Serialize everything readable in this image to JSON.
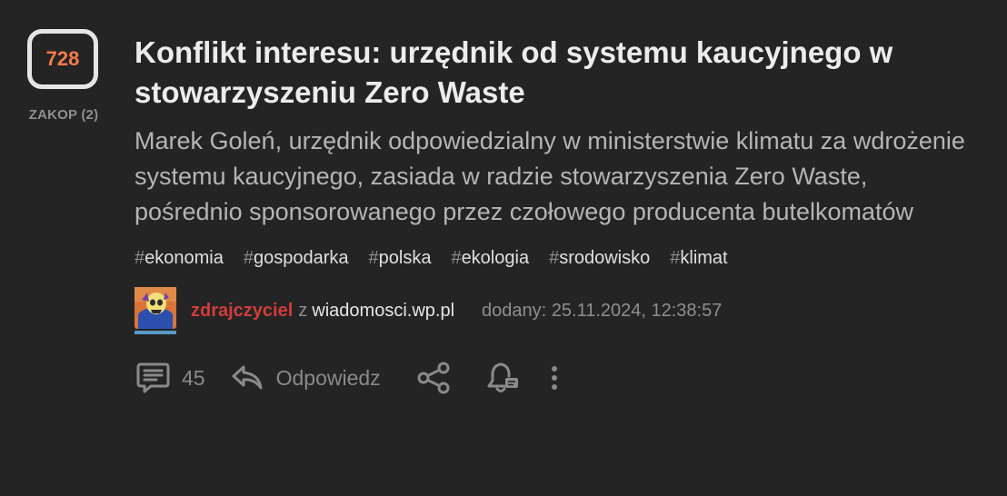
{
  "vote": {
    "count": "728",
    "bury_label": "ZAKOP (2)"
  },
  "article": {
    "title": "Konflikt interesu: urzędnik od systemu kaucyjnego w stowarzyszeniu Zero Waste",
    "description": "Marek Goleń, urzędnik odpowiedzialny w ministerstwie klimatu za wdrożenie systemu kaucyjnego, zasiada w radzie stowarzyszenia Zero Waste, pośrednio sponsorowanego przez czołowego producenta butelkomatów"
  },
  "tags": [
    {
      "hash": "#",
      "name": "ekonomia"
    },
    {
      "hash": "#",
      "name": "gospodarka"
    },
    {
      "hash": "#",
      "name": "polska"
    },
    {
      "hash": "#",
      "name": "ekologia"
    },
    {
      "hash": "#",
      "name": "srodowisko"
    },
    {
      "hash": "#",
      "name": "klimat"
    }
  ],
  "meta": {
    "author": "zdrajczyciel",
    "from_word": "z",
    "source": "wiadomosci.wp.pl",
    "added": "dodany: 25.11.2024, 12:38:57",
    "avatar_icon": "skeletor-avatar"
  },
  "actions": {
    "comments_icon": "comments-icon",
    "comments_count": "45",
    "reply_icon": "reply-icon",
    "reply_label": "Odpowiedz",
    "share_icon": "share-icon",
    "notify_icon": "bell-icon",
    "more_icon": "more-vertical-icon"
  },
  "colors": {
    "background": "#242424",
    "vote_count": "#f47a4a",
    "author": "#d23c3c"
  }
}
